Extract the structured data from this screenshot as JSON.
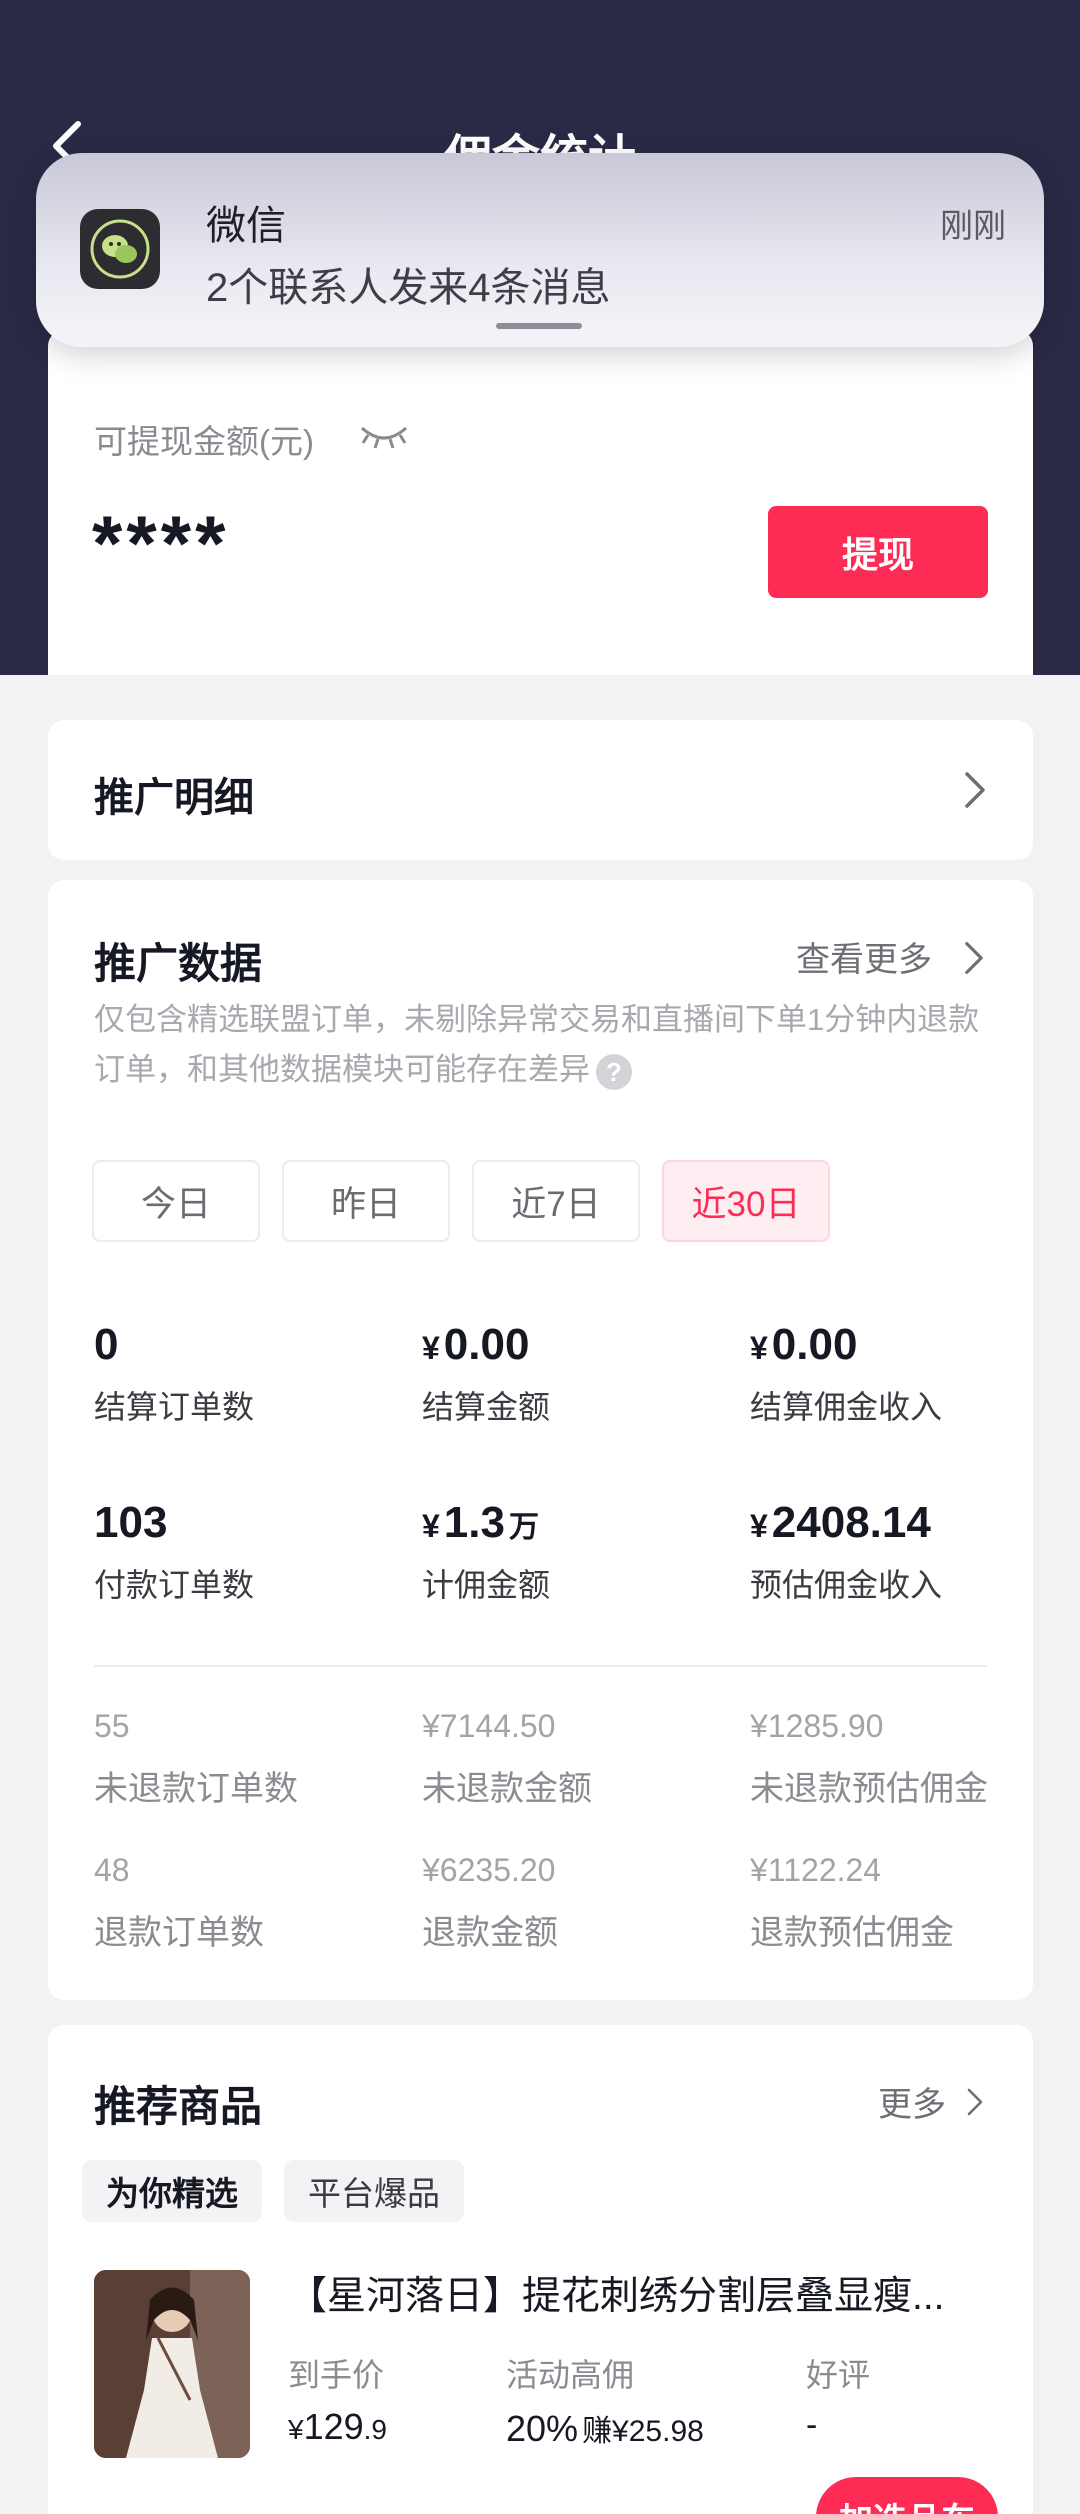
{
  "header": {
    "title": "佣金统计"
  },
  "notification": {
    "app_name": "微信",
    "message": "2个联系人发来4条消息",
    "time": "刚刚"
  },
  "balance": {
    "label": "可提现金额(元)",
    "value": "****",
    "withdraw_label": "提现"
  },
  "promo_detail": {
    "title": "推广明细"
  },
  "promo_data": {
    "title": "推广数据",
    "more_label": "查看更多",
    "note": "仅包含精选联盟订单，未剔除异常交易和直播间下单1分钟内退款订单，和其他数据模块可能存在差异",
    "help_glyph": "?",
    "tabs": [
      "今日",
      "昨日",
      "近7日",
      "近30日"
    ],
    "active_tab": "近30日",
    "currency": "¥",
    "metrics": [
      {
        "value": "0",
        "label": "结算订单数"
      },
      {
        "value": "0.00",
        "label": "结算金额"
      },
      {
        "value": "0.00",
        "label": "结算佣金收入"
      },
      {
        "value": "103",
        "label": "付款订单数"
      },
      {
        "value": "1.3",
        "unit": "万",
        "label": "计佣金额"
      },
      {
        "value": "2408.14",
        "label": "预估佣金收入"
      }
    ],
    "sub_metrics": [
      {
        "value": "55",
        "label": "未退款订单数"
      },
      {
        "value": "¥7144.50",
        "label": "未退款金额"
      },
      {
        "value": "¥1285.90",
        "label": "未退款预估佣金"
      },
      {
        "value": "48",
        "label": "退款订单数"
      },
      {
        "value": "¥6235.20",
        "label": "退款金额"
      },
      {
        "value": "¥1122.24",
        "label": "退款预估佣金"
      }
    ]
  },
  "recommend": {
    "title": "推荐商品",
    "more_label": "更多",
    "tabs": [
      "为你精选",
      "平台爆品"
    ],
    "product": {
      "name": "【星河落日】提花刺绣分割层叠显瘦...",
      "price_label": "到手价",
      "price_currency": "¥",
      "price_int": "129",
      "price_dec": ".9",
      "commission_label": "活动高佣",
      "commission_rate": "20%",
      "commission_earn": "赚¥25.98",
      "rating_label": "好评",
      "rating_value": "-",
      "add_label": "加选品车"
    }
  },
  "colors": {
    "accent": "#fe2c55",
    "header_bg": "#2a2a46"
  }
}
